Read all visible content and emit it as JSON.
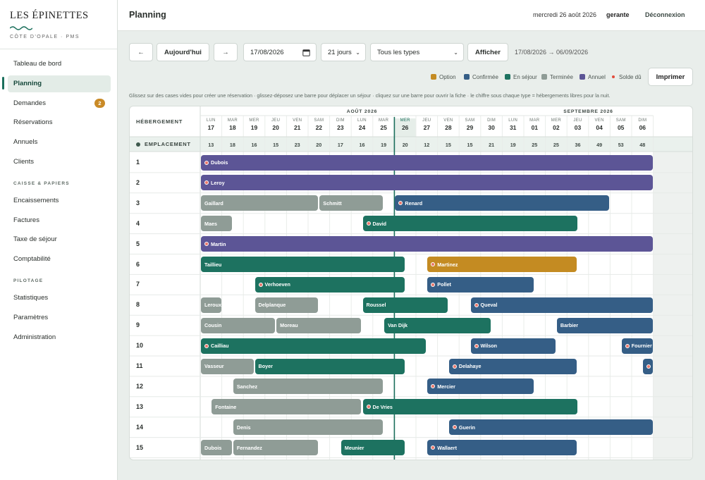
{
  "brand": {
    "name": "LES ÉPINETTES",
    "subtitle": "CÔTE D'OPALE · PMS"
  },
  "nav": {
    "tableau": "Tableau de bord",
    "planning": "Planning",
    "demandes": "Demandes",
    "demandes_badge": "2",
    "reservations": "Réservations",
    "annuels": "Annuels",
    "clients": "Clients",
    "section_caisse": "CAISSE & PAPIERS",
    "encaissements": "Encaissements",
    "factures": "Factures",
    "taxe": "Taxe de séjour",
    "compta": "Comptabilité",
    "section_pilotage": "PILOTAGE",
    "stats": "Statistiques",
    "params": "Paramètres",
    "admin": "Administration"
  },
  "topbar": {
    "title": "Planning",
    "date": "mercredi 26 août 2026",
    "user": "gerante",
    "logout": "Déconnexion"
  },
  "toolbar": {
    "prev": "←",
    "today": "Aujourd'hui",
    "next": "→",
    "date_value": "17/08/2026",
    "date_icon": "calendar-icon",
    "days": "21 jours",
    "types": "Tous les types",
    "show": "Afficher",
    "range": "17/08/2026 → 06/09/2026"
  },
  "legend": {
    "option": "Option",
    "confirmee": "Confirmée",
    "en_sejour": "En séjour",
    "terminee": "Terminée",
    "annuel": "Annuel",
    "solde": "Solde dû",
    "print": "Imprimer"
  },
  "colors": {
    "option": "#c48b22",
    "confirmee": "#355e86",
    "en_sejour": "#1d7260",
    "terminee": "#8f9c96",
    "annuel": "#5c5596",
    "solde": "#e24b3b",
    "accent": "#1b6f5c"
  },
  "hint": "Glissez sur des cases vides pour créer une réservation · glissez-déposez une barre pour déplacer un séjour · cliquez sur une barre pour ouvrir la fiche · le chiffre sous chaque type = hébergements libres pour la nuit.",
  "grid": {
    "header_label": "HÉBERGEMENT",
    "months": [
      "AOÛT 2026",
      "SEPTEMBRE 2026"
    ],
    "today_index": 9,
    "days": [
      {
        "name": "LUN",
        "num": "17"
      },
      {
        "name": "MAR",
        "num": "18"
      },
      {
        "name": "MER",
        "num": "19"
      },
      {
        "name": "JEU",
        "num": "20"
      },
      {
        "name": "VEN",
        "num": "21"
      },
      {
        "name": "SAM",
        "num": "22"
      },
      {
        "name": "DIM",
        "num": "23"
      },
      {
        "name": "LUN",
        "num": "24"
      },
      {
        "name": "MAR",
        "num": "25"
      },
      {
        "name": "MER",
        "num": "26"
      },
      {
        "name": "JEU",
        "num": "27"
      },
      {
        "name": "VEN",
        "num": "28"
      },
      {
        "name": "SAM",
        "num": "29"
      },
      {
        "name": "DIM",
        "num": "30"
      },
      {
        "name": "LUN",
        "num": "31"
      },
      {
        "name": "MAR",
        "num": "01"
      },
      {
        "name": "MER",
        "num": "02"
      },
      {
        "name": "JEU",
        "num": "03"
      },
      {
        "name": "VEN",
        "num": "04"
      },
      {
        "name": "SAM",
        "num": "05"
      },
      {
        "name": "DIM",
        "num": "06"
      }
    ],
    "type_label": "EMPLACEMENT",
    "counts": [
      "13",
      "18",
      "16",
      "15",
      "23",
      "20",
      "17",
      "16",
      "19",
      "20",
      "12",
      "15",
      "15",
      "21",
      "19",
      "25",
      "25",
      "36",
      "49",
      "53",
      "48"
    ],
    "rooms": [
      {
        "label": "1",
        "bars": [
          {
            "name": "Dubois",
            "status": "annuel",
            "start": 0,
            "end": 21,
            "solde": true
          }
        ]
      },
      {
        "label": "2",
        "bars": [
          {
            "name": "Leroy",
            "status": "annuel",
            "start": 0,
            "end": 21,
            "solde": true
          }
        ]
      },
      {
        "label": "3",
        "bars": [
          {
            "name": "Gaillard",
            "status": "terminee",
            "start": 0,
            "end": 5.5
          },
          {
            "name": "Schmitt",
            "status": "terminee",
            "start": 5.5,
            "end": 8.5
          },
          {
            "name": "Renard",
            "status": "confirmee",
            "start": 9,
            "end": 19,
            "solde": true
          }
        ]
      },
      {
        "label": "4",
        "bars": [
          {
            "name": "Maes",
            "status": "terminee",
            "start": 0,
            "end": 1.5
          },
          {
            "name": "David",
            "status": "en_sejour",
            "start": 7.5,
            "end": 17.5,
            "solde": true
          }
        ]
      },
      {
        "label": "5",
        "bars": [
          {
            "name": "Martin",
            "status": "annuel",
            "start": 0,
            "end": 21,
            "solde": true
          }
        ]
      },
      {
        "label": "6",
        "bars": [
          {
            "name": "Taillieu",
            "status": "en_sejour",
            "start": 0,
            "end": 9.5
          },
          {
            "name": "Martinez",
            "status": "option",
            "start": 10.5,
            "end": 17.5,
            "solde": true
          }
        ]
      },
      {
        "label": "7",
        "bars": [
          {
            "name": "Verhoeven",
            "status": "en_sejour",
            "start": 2.5,
            "end": 9.5,
            "solde": true
          },
          {
            "name": "Pollet",
            "status": "confirmee",
            "start": 10.5,
            "end": 15.5,
            "solde": true
          }
        ]
      },
      {
        "label": "8",
        "bars": [
          {
            "name": "Leroux",
            "status": "terminee",
            "start": 0,
            "end": 1
          },
          {
            "name": "Delplanque",
            "status": "terminee",
            "start": 2.5,
            "end": 5.5
          },
          {
            "name": "Roussel",
            "status": "en_sejour",
            "start": 7.5,
            "end": 11.5
          },
          {
            "name": "Queval",
            "status": "confirmee",
            "start": 12.5,
            "end": 21,
            "solde": true
          }
        ]
      },
      {
        "label": "9",
        "bars": [
          {
            "name": "Cousin",
            "status": "terminee",
            "start": 0,
            "end": 3.5
          },
          {
            "name": "Moreau",
            "status": "terminee",
            "start": 3.5,
            "end": 7.5
          },
          {
            "name": "Van Dijk",
            "status": "en_sejour",
            "start": 8.5,
            "end": 13.5
          },
          {
            "name": "Barbier",
            "status": "confirmee",
            "start": 16.5,
            "end": 21
          }
        ]
      },
      {
        "label": "10",
        "bars": [
          {
            "name": "Cailliau",
            "status": "en_sejour",
            "start": 0,
            "end": 10.5,
            "solde": true
          },
          {
            "name": "Wilson",
            "status": "confirmee",
            "start": 12.5,
            "end": 16.5,
            "solde": true
          },
          {
            "name": "Fournier",
            "status": "confirmee",
            "start": 19.5,
            "end": 21,
            "solde": true
          }
        ]
      },
      {
        "label": "11",
        "bars": [
          {
            "name": "Vasseur",
            "status": "terminee",
            "start": 0,
            "end": 2.5
          },
          {
            "name": "Boyer",
            "status": "en_sejour",
            "start": 2.5,
            "end": 9.5
          },
          {
            "name": "Delahaye",
            "status": "confirmee",
            "start": 11.5,
            "end": 17.5,
            "solde": true
          },
          {
            "name": "",
            "status": "confirmee",
            "start": 20.5,
            "end": 21,
            "solde": true
          }
        ]
      },
      {
        "label": "12",
        "bars": [
          {
            "name": "Sanchez",
            "status": "terminee",
            "start": 1.5,
            "end": 8.5
          },
          {
            "name": "Mercier",
            "status": "confirmee",
            "start": 10.5,
            "end": 15.5,
            "solde": true
          }
        ]
      },
      {
        "label": "13",
        "bars": [
          {
            "name": "Fontaine",
            "status": "terminee",
            "start": 0.5,
            "end": 7.5
          },
          {
            "name": "De Vries",
            "status": "en_sejour",
            "start": 7.5,
            "end": 17.5,
            "solde": true
          }
        ]
      },
      {
        "label": "14",
        "bars": [
          {
            "name": "Denis",
            "status": "terminee",
            "start": 1.5,
            "end": 8.5
          },
          {
            "name": "Guerin",
            "status": "confirmee",
            "start": 11.5,
            "end": 21,
            "solde": true
          }
        ]
      },
      {
        "label": "15",
        "bars": [
          {
            "name": "Dubois",
            "status": "terminee",
            "start": 0,
            "end": 1.5
          },
          {
            "name": "Fernandez",
            "status": "terminee",
            "start": 1.5,
            "end": 5.5
          },
          {
            "name": "Meunier",
            "status": "en_sejour",
            "start": 6.5,
            "end": 9.5
          },
          {
            "name": "Wallaert",
            "status": "confirmee",
            "start": 10.5,
            "end": 17.5,
            "solde": true
          }
        ]
      }
    ]
  }
}
